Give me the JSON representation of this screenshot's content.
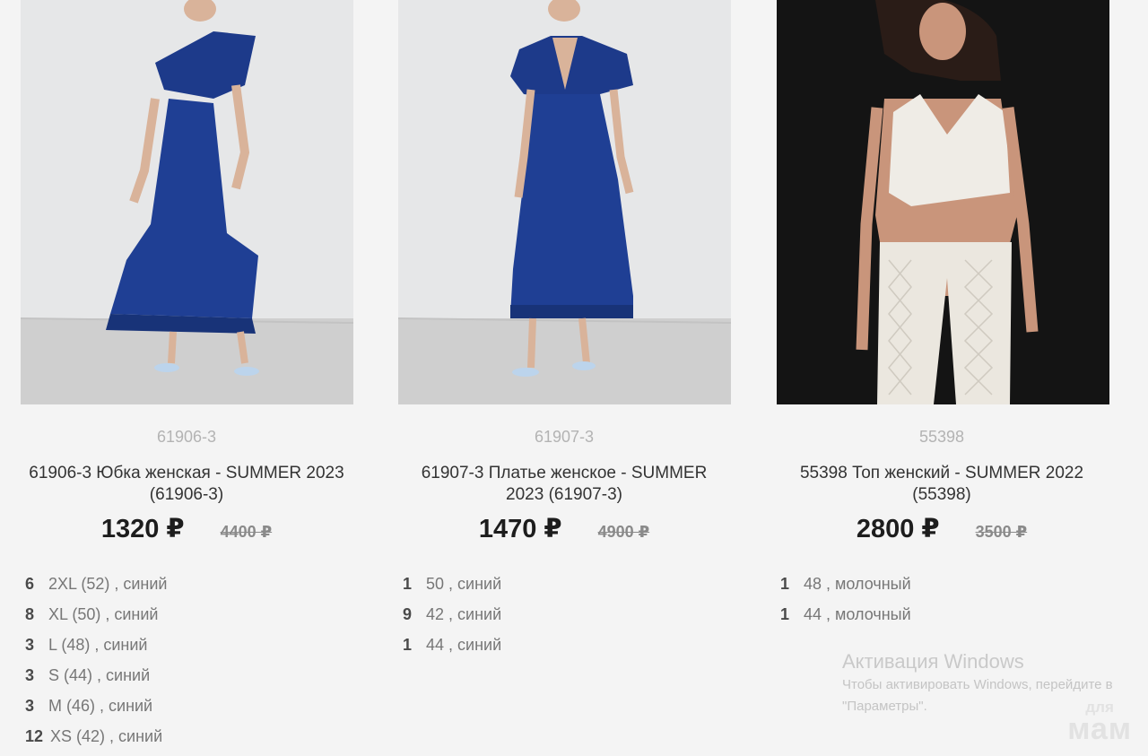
{
  "products": [
    {
      "sku": "61906-3",
      "title": "61906-3 Юбка женская - SUMMER 2023 (61906-3)",
      "price": "1320 ₽",
      "old_price": "4400 ₽",
      "photo_icon": "blue-one-shoulder-ruffle-dress-photo",
      "sizes": [
        {
          "qty": "6",
          "label": "2XL (52) , синий"
        },
        {
          "qty": "8",
          "label": "XL (50) , синий"
        },
        {
          "qty": "3",
          "label": "L (48) , синий"
        },
        {
          "qty": "3",
          "label": "S (44) , синий"
        },
        {
          "qty": "3",
          "label": "M (46) , синий"
        },
        {
          "qty": "12",
          "label": "XS (42) , синий"
        }
      ]
    },
    {
      "sku": "61907-3",
      "title": "61907-3 Платье женское - SUMMER 2023 (61907-3)",
      "price": "1470 ₽",
      "old_price": "4900 ₽",
      "photo_icon": "blue-v-neck-dress-photo",
      "sizes": [
        {
          "qty": "1",
          "label": "50 , синий"
        },
        {
          "qty": "9",
          "label": "42 , синий"
        },
        {
          "qty": "1",
          "label": "44 , синий"
        }
      ]
    },
    {
      "sku": "55398",
      "title": "55398 Топ женский - SUMMER 2022 (55398)",
      "price": "2800 ₽",
      "old_price": "3500 ₽",
      "photo_icon": "white-lace-top-and-pants-photo",
      "sizes": [
        {
          "qty": "1",
          "label": "48 , молочный"
        },
        {
          "qty": "1",
          "label": "44 , молочный"
        }
      ]
    }
  ],
  "windows_activation": {
    "title": "Активация Windows",
    "line1": "Чтобы активировать Windows, перейдите в",
    "line2": "\"Параметры\"."
  },
  "watermark": {
    "top": "для",
    "bottom": "мам"
  },
  "colors": {
    "background": "#f4f4f4",
    "dress_blue": "#1d3a8a",
    "studio_gray": "#dcdcdc",
    "dark_backdrop": "#141414",
    "lace_white": "#efece6"
  }
}
